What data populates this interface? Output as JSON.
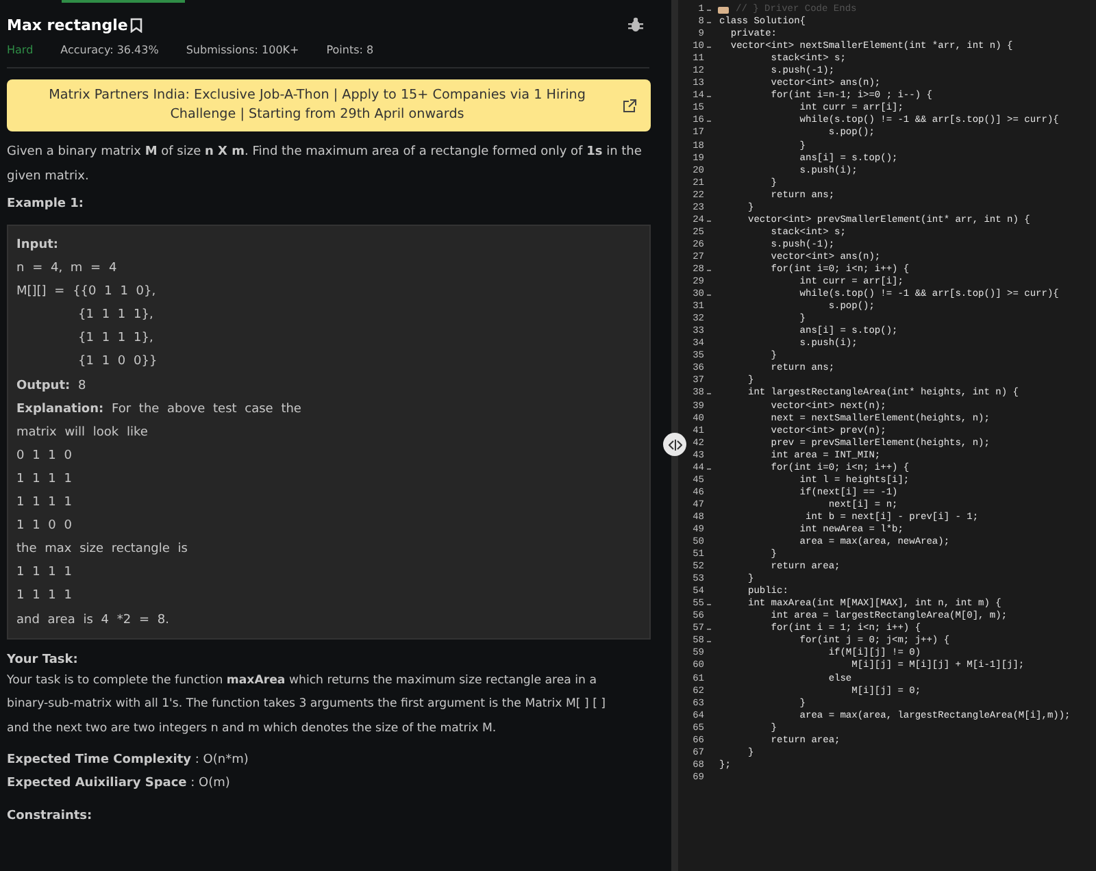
{
  "problem": {
    "title": "Max rectangle",
    "difficulty": "Hard",
    "meta": [
      "Accuracy: 36.43%",
      "Submissions: 100K+",
      "Points: 8"
    ],
    "banner": "Matrix Partners India: Exclusive Job-A-Thon | Apply to 15+ Companies via 1 Hiring Challenge | Starting from 29th April onwards",
    "description": "Given a binary matrix **M** of size **n X m**. Find the maximum area of a rectangle formed only of **1s** in the given matrix.",
    "example_title": "Example 1:",
    "example_lines": [
      {
        "kind": "heading",
        "text": "Input:"
      },
      {
        "kind": "plain",
        "text": "n = 4, m = 4"
      },
      {
        "kind": "plain",
        "text": "M[][] = {{0 1 1 0},"
      },
      {
        "kind": "indented",
        "text": "{1 1 1 1},"
      },
      {
        "kind": "indented",
        "text": "{1 1 1 1},"
      },
      {
        "kind": "indented",
        "text": "{1 1 0 0}}"
      },
      {
        "kind": "plain",
        "text": "**Output:** 8"
      },
      {
        "kind": "plain",
        "text": "**Explanation:** For the above test case the"
      },
      {
        "kind": "plain",
        "text": "matrix will look like"
      },
      {
        "kind": "plain",
        "text": "0 1 1 0"
      },
      {
        "kind": "plain",
        "text": "1 1 1 1"
      },
      {
        "kind": "plain",
        "text": "1 1 1 1"
      },
      {
        "kind": "plain",
        "text": "1 1 0 0"
      },
      {
        "kind": "plain",
        "text": "the max size rectangle is"
      },
      {
        "kind": "plain",
        "text": "1 1 1 1"
      },
      {
        "kind": "plain",
        "text": "1 1 1 1"
      },
      {
        "kind": "plain",
        "text": "and area is 4 *2 = 8."
      }
    ],
    "task_title": "Your Task:",
    "task_text": "Your task is to complete the function **maxArea** which returns the maximum size rectangle area in a binary-sub-matrix with all 1's. The function takes 3 arguments the first argument is the Matrix M[ ] [ ] and the next two are two integers n and m which denotes the size of the matrix M.",
    "complexity": [
      "**Expected Time Complexity** : O(n*m)",
      "**Expected Auixiliary Space** : O(m)"
    ],
    "constraints_title": "Constraints:"
  },
  "editor": {
    "lines": [
      {
        "num": "1",
        "fold": true,
        "folded": true,
        "text": "// } Driver Code Ends"
      },
      {
        "num": "8",
        "fold": true,
        "text": "class Solution{"
      },
      {
        "num": "9",
        "fold": false,
        "text": "  private:"
      },
      {
        "num": "10",
        "fold": true,
        "text": "  vector<int> nextSmallerElement(int *arr, int n) {"
      },
      {
        "num": "11",
        "fold": false,
        "text": "         stack<int> s;"
      },
      {
        "num": "12",
        "fold": false,
        "text": "         s.push(-1);"
      },
      {
        "num": "13",
        "fold": false,
        "text": "         vector<int> ans(n);"
      },
      {
        "num": "14",
        "fold": true,
        "text": "         for(int i=n-1; i>=0 ; i--) {"
      },
      {
        "num": "15",
        "fold": false,
        "text": "              int curr = arr[i];"
      },
      {
        "num": "16",
        "fold": true,
        "text": "              while(s.top() != -1 && arr[s.top()] >= curr){"
      },
      {
        "num": "17",
        "fold": false,
        "text": "                   s.pop();"
      },
      {
        "num": "18",
        "fold": false,
        "text": "              }"
      },
      {
        "num": "19",
        "fold": false,
        "text": "              ans[i] = s.top();"
      },
      {
        "num": "20",
        "fold": false,
        "text": "              s.push(i);"
      },
      {
        "num": "21",
        "fold": false,
        "text": "         }"
      },
      {
        "num": "22",
        "fold": false,
        "text": "         return ans;"
      },
      {
        "num": "23",
        "fold": false,
        "text": "     }"
      },
      {
        "num": "24",
        "fold": true,
        "text": "     vector<int> prevSmallerElement(int* arr, int n) {"
      },
      {
        "num": "25",
        "fold": false,
        "text": "         stack<int> s;"
      },
      {
        "num": "26",
        "fold": false,
        "text": "         s.push(-1);"
      },
      {
        "num": "27",
        "fold": false,
        "text": "         vector<int> ans(n);"
      },
      {
        "num": "28",
        "fold": true,
        "text": "         for(int i=0; i<n; i++) {"
      },
      {
        "num": "29",
        "fold": false,
        "text": "              int curr = arr[i];"
      },
      {
        "num": "30",
        "fold": true,
        "text": "              while(s.top() != -1 && arr[s.top()] >= curr){"
      },
      {
        "num": "31",
        "fold": false,
        "text": "                   s.pop();"
      },
      {
        "num": "32",
        "fold": false,
        "text": "              }"
      },
      {
        "num": "33",
        "fold": false,
        "text": "              ans[i] = s.top();"
      },
      {
        "num": "34",
        "fold": false,
        "text": "              s.push(i);"
      },
      {
        "num": "35",
        "fold": false,
        "text": "         }"
      },
      {
        "num": "36",
        "fold": false,
        "text": "         return ans;"
      },
      {
        "num": "37",
        "fold": false,
        "text": "     }"
      },
      {
        "num": "38",
        "fold": true,
        "text": "     int largestRectangleArea(int* heights, int n) {"
      },
      {
        "num": "39",
        "fold": false,
        "text": "         vector<int> next(n);"
      },
      {
        "num": "40",
        "fold": false,
        "text": "         next = nextSmallerElement(heights, n);"
      },
      {
        "num": "41",
        "fold": false,
        "text": "         vector<int> prev(n);"
      },
      {
        "num": "42",
        "fold": false,
        "text": "         prev = prevSmallerElement(heights, n);"
      },
      {
        "num": "43",
        "fold": false,
        "text": "         int area = INT_MIN;"
      },
      {
        "num": "44",
        "fold": true,
        "text": "         for(int i=0; i<n; i++) {"
      },
      {
        "num": "45",
        "fold": false,
        "text": "              int l = heights[i];"
      },
      {
        "num": "46",
        "fold": false,
        "text": "              if(next[i] == -1)"
      },
      {
        "num": "47",
        "fold": false,
        "text": "                   next[i] = n;"
      },
      {
        "num": "48",
        "fold": false,
        "text": "               int b = next[i] - prev[i] - 1;"
      },
      {
        "num": "49",
        "fold": false,
        "text": "              int newArea = l*b;"
      },
      {
        "num": "50",
        "fold": false,
        "text": "              area = max(area, newArea);"
      },
      {
        "num": "51",
        "fold": false,
        "text": "         }"
      },
      {
        "num": "52",
        "fold": false,
        "text": "         return area;"
      },
      {
        "num": "53",
        "fold": false,
        "text": "     }"
      },
      {
        "num": "54",
        "fold": false,
        "text": "     public:"
      },
      {
        "num": "55",
        "fold": true,
        "text": "     int maxArea(int M[MAX][MAX], int n, int m) {"
      },
      {
        "num": "56",
        "fold": false,
        "text": "         int area = largestRectangleArea(M[0], m);"
      },
      {
        "num": "57",
        "fold": true,
        "text": "         for(int i = 1; i<n; i++) {"
      },
      {
        "num": "58",
        "fold": true,
        "text": "              for(int j = 0; j<m; j++) {"
      },
      {
        "num": "59",
        "fold": false,
        "text": "                   if(M[i][j] != 0)"
      },
      {
        "num": "60",
        "fold": false,
        "text": "                       M[i][j] = M[i][j] + M[i-1][j];"
      },
      {
        "num": "61",
        "fold": false,
        "text": "                   else"
      },
      {
        "num": "62",
        "fold": false,
        "text": "                       M[i][j] = 0;"
      },
      {
        "num": "63",
        "fold": false,
        "text": "              }"
      },
      {
        "num": "64",
        "fold": false,
        "text": "              area = max(area, largestRectangleArea(M[i],m));"
      },
      {
        "num": "65",
        "fold": false,
        "text": "         }"
      },
      {
        "num": "66",
        "fold": false,
        "text": "         return area;"
      },
      {
        "num": "67",
        "fold": false,
        "text": "     }"
      },
      {
        "num": "68",
        "fold": false,
        "text": "};"
      },
      {
        "num": "69",
        "fold": false
      }
    ]
  }
}
